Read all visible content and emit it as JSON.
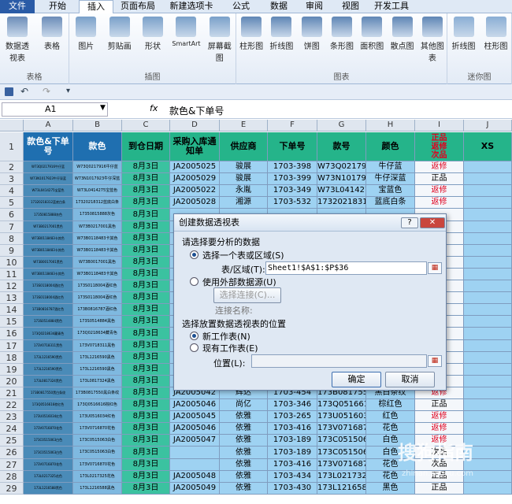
{
  "ribbon": {
    "tabs": [
      "文件",
      "开始",
      "插入",
      "页面布局",
      "新建选项卡",
      "公式",
      "数据",
      "审阅",
      "视图",
      "开发工具"
    ],
    "groups": [
      {
        "label": "表格",
        "buttons": [
          "数据透视表",
          "表格"
        ]
      },
      {
        "label": "插图",
        "buttons": [
          "图片",
          "剪贴画",
          "形状",
          "SmartArt",
          "屏幕截图"
        ]
      },
      {
        "label": "图表",
        "buttons": [
          "柱形图",
          "折线图",
          "饼图",
          "条形图",
          "面积图",
          "散点图",
          "其他图表"
        ]
      },
      {
        "label": "迷你图",
        "buttons": [
          "折线图",
          "柱形图"
        ]
      }
    ]
  },
  "formula": {
    "namebox": "A1",
    "fx": "fx",
    "content": "款色&下单号"
  },
  "columns": [
    "A",
    "B",
    "C",
    "D",
    "E",
    "F",
    "G",
    "H",
    "I",
    "J"
  ],
  "headers": [
    "款色&下单号",
    "款色",
    "到仓日期",
    "采购入库通知单",
    "供应商",
    "下单号",
    "款号",
    "颜色",
    "正品\n返修\n次品",
    "XS"
  ],
  "rows": [
    [
      "W73Q0217916牛仔蓝",
      "W73Q0217916牛仔蓝",
      "8月3日",
      "JA2005025",
      "骏展",
      "1703-398",
      "W73Q0217916",
      "牛仔蓝",
      "返修"
    ],
    [
      "W73N1017923牛仔深蓝",
      "W73N1017923牛仔深蓝",
      "8月3日",
      "JA2005029",
      "骏展",
      "1703-399",
      "W73N1017923",
      "牛仔深蓝",
      "正品"
    ],
    [
      "W73L0414275宝蓝色",
      "W73L0414275宝蓝色",
      "8月3日",
      "JA2005022",
      "永胤",
      "1703-349",
      "W73L0414275",
      "宝蓝色",
      "返修"
    ],
    [
      "17320218312蓝底白条",
      "17320218312蓝底白条",
      "8月3日",
      "JA2005028",
      "湘源",
      "1703-532",
      "17320218312",
      "蓝底白条",
      "返修"
    ],
    [
      "17350815888灰色",
      "17350815888灰色",
      "8月3日",
      "",
      "",
      "",
      "",
      "",
      ""
    ],
    [
      "W73B0217001黑色",
      "W73B0217001黑色",
      "8月3日",
      "",
      "",
      "",
      "",
      "",
      ""
    ],
    [
      "W73B0118483卡其色",
      "W73B0118483卡其色",
      "8月3日",
      "",
      "",
      "",
      "",
      "",
      ""
    ],
    [
      "W73B0118483卡其色",
      "W73B0118483卡其色",
      "8月3日",
      "",
      "",
      "",
      "",
      "",
      ""
    ],
    [
      "W73B0017001黑色",
      "W73B0017001黑色",
      "8月3日",
      "",
      "",
      "",
      "",
      "",
      ""
    ],
    [
      "W73B0118483卡其色",
      "W73B0118483卡其色",
      "8月3日",
      "",
      "",
      "",
      "",
      "",
      ""
    ],
    [
      "173S0118004酒红色",
      "173S0118004酒红色",
      "8月3日",
      "",
      "",
      "",
      "",
      "",
      ""
    ],
    [
      "173S0118004酒红色",
      "173S0118004酒红色",
      "8月3日",
      "",
      "",
      "",
      "",
      "",
      ""
    ],
    [
      "173B0816787酒红色",
      "173B0816787酒红色",
      "8月3日",
      "",
      "",
      "",
      "",
      "",
      ""
    ],
    [
      "173S0514884黑色",
      "173S0514884黑色",
      "8月3日",
      "",
      "",
      "",
      "",
      "",
      ""
    ],
    [
      "173Q0218634藏青色",
      "173Q0218634藏青色",
      "8月3日",
      "",
      "",
      "",
      "",
      "",
      ""
    ],
    [
      "173V0718311黑色",
      "173V0718311黑色",
      "8月3日",
      "",
      "",
      "",
      "",
      "",
      ""
    ],
    [
      "173L1216590黑色",
      "173L1216590黑色",
      "8月3日",
      "",
      "",
      "",
      "",
      "",
      ""
    ],
    [
      "173L1216590黑色",
      "173L1216590黑色",
      "8月3日",
      "",
      "",
      "",
      "",
      "",
      ""
    ],
    [
      "173L0817324黑色",
      "173L0817324黑色",
      "8月3日",
      "",
      "",
      "",
      "",
      "",
      ""
    ],
    [
      "173B0817550黑白条纹",
      "173B0817550黑白条纹",
      "8月3日",
      "JA2005042",
      "辉达",
      "1703-454",
      "173B0817550",
      "黑白条纹",
      "返修"
    ],
    [
      "173Q0516616棕红色",
      "173Q0516616棕红色",
      "8月3日",
      "JA2005046",
      "尚亿",
      "1703-346",
      "173Q0516616",
      "棕红色",
      "正品"
    ],
    [
      "173U0516034红色",
      "173U0516034红色",
      "8月3日",
      "JA2005045",
      "依雅",
      "1703-265",
      "173U0516034",
      "红色",
      "返修"
    ],
    [
      "173V0716870花色",
      "173V0716870花色",
      "8月3日",
      "JA2005046",
      "依雅",
      "1703-416",
      "173V0716870",
      "花色",
      "返修"
    ],
    [
      "173C0515063白色",
      "173C0515063白色",
      "8月3日",
      "JA2005047",
      "依雅",
      "1703-189",
      "173C0515063",
      "白色",
      "返修"
    ],
    [
      "173C0515063白色",
      "173C0515063白色",
      "8月3日",
      "",
      "依雅",
      "1703-189",
      "173C0515063",
      "白色",
      "次品"
    ],
    [
      "173V0716870花色",
      "173V0716870花色",
      "8月3日",
      "",
      "依雅",
      "1703-416",
      "173V0716870",
      "花色",
      "次品"
    ],
    [
      "173L0217325花色",
      "173L0217325花色",
      "8月3日",
      "JA2005048",
      "依雅",
      "1703-434",
      "173L0217325",
      "花色",
      "正品"
    ],
    [
      "173L1216588黑色",
      "173L1216588黑色",
      "8月3日",
      "JA2005049",
      "依雅",
      "1703-430",
      "173L1216588",
      "黑色",
      "正品"
    ]
  ],
  "dialog": {
    "title": "创建数据透视表",
    "section1": "请选择要分析的数据",
    "opt1": "选择一个表或区域(S)",
    "range_label": "表/区域(T):",
    "range_value": "Sheet1!$A$1:$P$36",
    "opt2": "使用外部数据源(U)",
    "conn_btn": "选择连接(C)...",
    "conn_label": "连接名称:",
    "section2": "选择放置数据透视表的位置",
    "opt3": "新工作表(N)",
    "opt4": "现有工作表(E)",
    "loc_label": "位置(L):",
    "ok": "确定",
    "cancel": "取消",
    "help": "?",
    "close": "✕"
  },
  "watermark": {
    "text": "搜狗指南",
    "url": "zhinan.sogou.com"
  }
}
